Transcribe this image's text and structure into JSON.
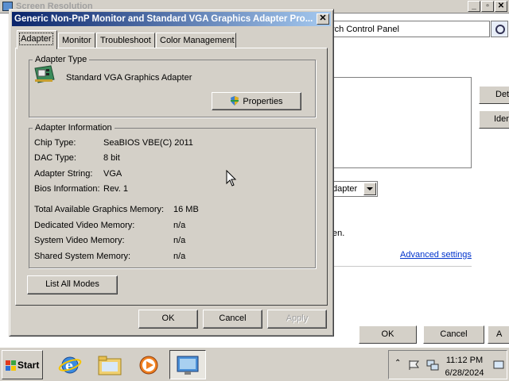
{
  "background_window": {
    "title": "Screen Resolution",
    "search_text": "rch Control Panel",
    "side_buttons": [
      "Det",
      "Iden"
    ],
    "select_value": "dapter",
    "partial_text": "en.",
    "advanced_link": "Advanced settings",
    "ok_label": "OK",
    "cancel_label": "Cancel",
    "apply_label": "A"
  },
  "dialog": {
    "title": "Generic Non-PnP Monitor and Standard VGA Graphics Adapter Pro...",
    "close_glyph": "✕",
    "tabs": [
      {
        "label": "Adapter",
        "active": true
      },
      {
        "label": "Monitor",
        "active": false
      },
      {
        "label": "Troubleshoot",
        "active": false
      },
      {
        "label": "Color Management",
        "active": false
      }
    ],
    "adapter_type": {
      "group_label": "Adapter Type",
      "adapter_name": "Standard VGA Graphics Adapter",
      "properties_label": "Properties"
    },
    "adapter_info": {
      "group_label": "Adapter Information",
      "rows": [
        {
          "label": "Chip Type:",
          "value": "SeaBIOS VBE(C) 2011"
        },
        {
          "label": "DAC Type:",
          "value": "8 bit"
        },
        {
          "label": "Adapter String:",
          "value": "VGA"
        },
        {
          "label": "Bios Information:",
          "value": "Rev. 1"
        }
      ],
      "memory_rows": [
        {
          "label": "Total Available Graphics Memory:",
          "value": "16 MB"
        },
        {
          "label": "Dedicated Video Memory:",
          "value": "n/a"
        },
        {
          "label": "System Video Memory:",
          "value": "n/a"
        },
        {
          "label": "Shared System Memory:",
          "value": "n/a"
        }
      ]
    },
    "list_all_modes_label": "List All Modes",
    "ok_label": "OK",
    "cancel_label": "Cancel",
    "apply_label": "Apply"
  },
  "taskbar": {
    "start_label": "Start",
    "clock_time": "11:12 PM",
    "clock_date": "6/28/2024",
    "apps": [
      "internet-explorer",
      "file-explorer",
      "media-player",
      "screen-resolution"
    ]
  },
  "colors": {
    "title_start": "#0a246a",
    "title_end": "#a6caf0",
    "face": "#d4d0c8",
    "link": "#0033cc"
  }
}
